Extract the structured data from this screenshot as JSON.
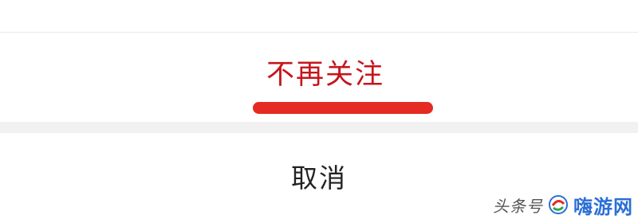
{
  "action_sheet": {
    "unfollow_label": "不再关注",
    "cancel_label": "取消"
  },
  "watermark": {
    "source_text": "头条号",
    "brand_text": "嗨游网"
  },
  "colors": {
    "unfollow_text": "#c4161c",
    "underline_mark": "#e52a23",
    "cancel_text": "#222222",
    "separator": "#f1f1f1",
    "brand": "#2b6fd6"
  }
}
